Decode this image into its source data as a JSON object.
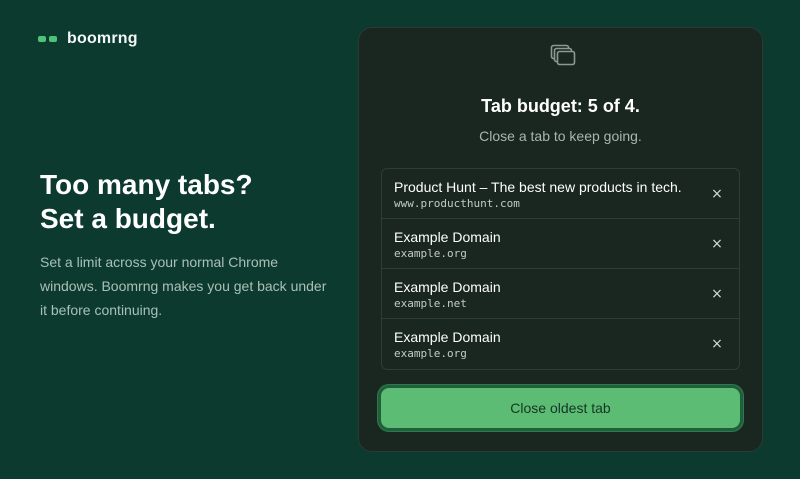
{
  "brand": {
    "name": "boomrng",
    "accent_color": "#4cc27a"
  },
  "hero": {
    "title_line1": "Too many tabs?",
    "title_line2": "Set a budget.",
    "description": "Set a limit across your normal Chrome windows. Boomrng makes you get back under it before continuing."
  },
  "panel": {
    "icon": "tabs-stack-icon",
    "title": "Tab budget: 5 of 4.",
    "subtitle": "Close a tab to keep going.",
    "tabs": [
      {
        "title": "Product Hunt – The best new products in tech.",
        "url": "www.producthunt.com",
        "close_label": "×"
      },
      {
        "title": "Example Domain",
        "url": "example.org",
        "close_label": "×"
      },
      {
        "title": "Example Domain",
        "url": "example.net",
        "close_label": "×"
      },
      {
        "title": "Example Domain",
        "url": "example.org",
        "close_label": "×"
      }
    ],
    "primary_button_label": "Close oldest tab",
    "primary_button_color": "#5dbc73"
  }
}
